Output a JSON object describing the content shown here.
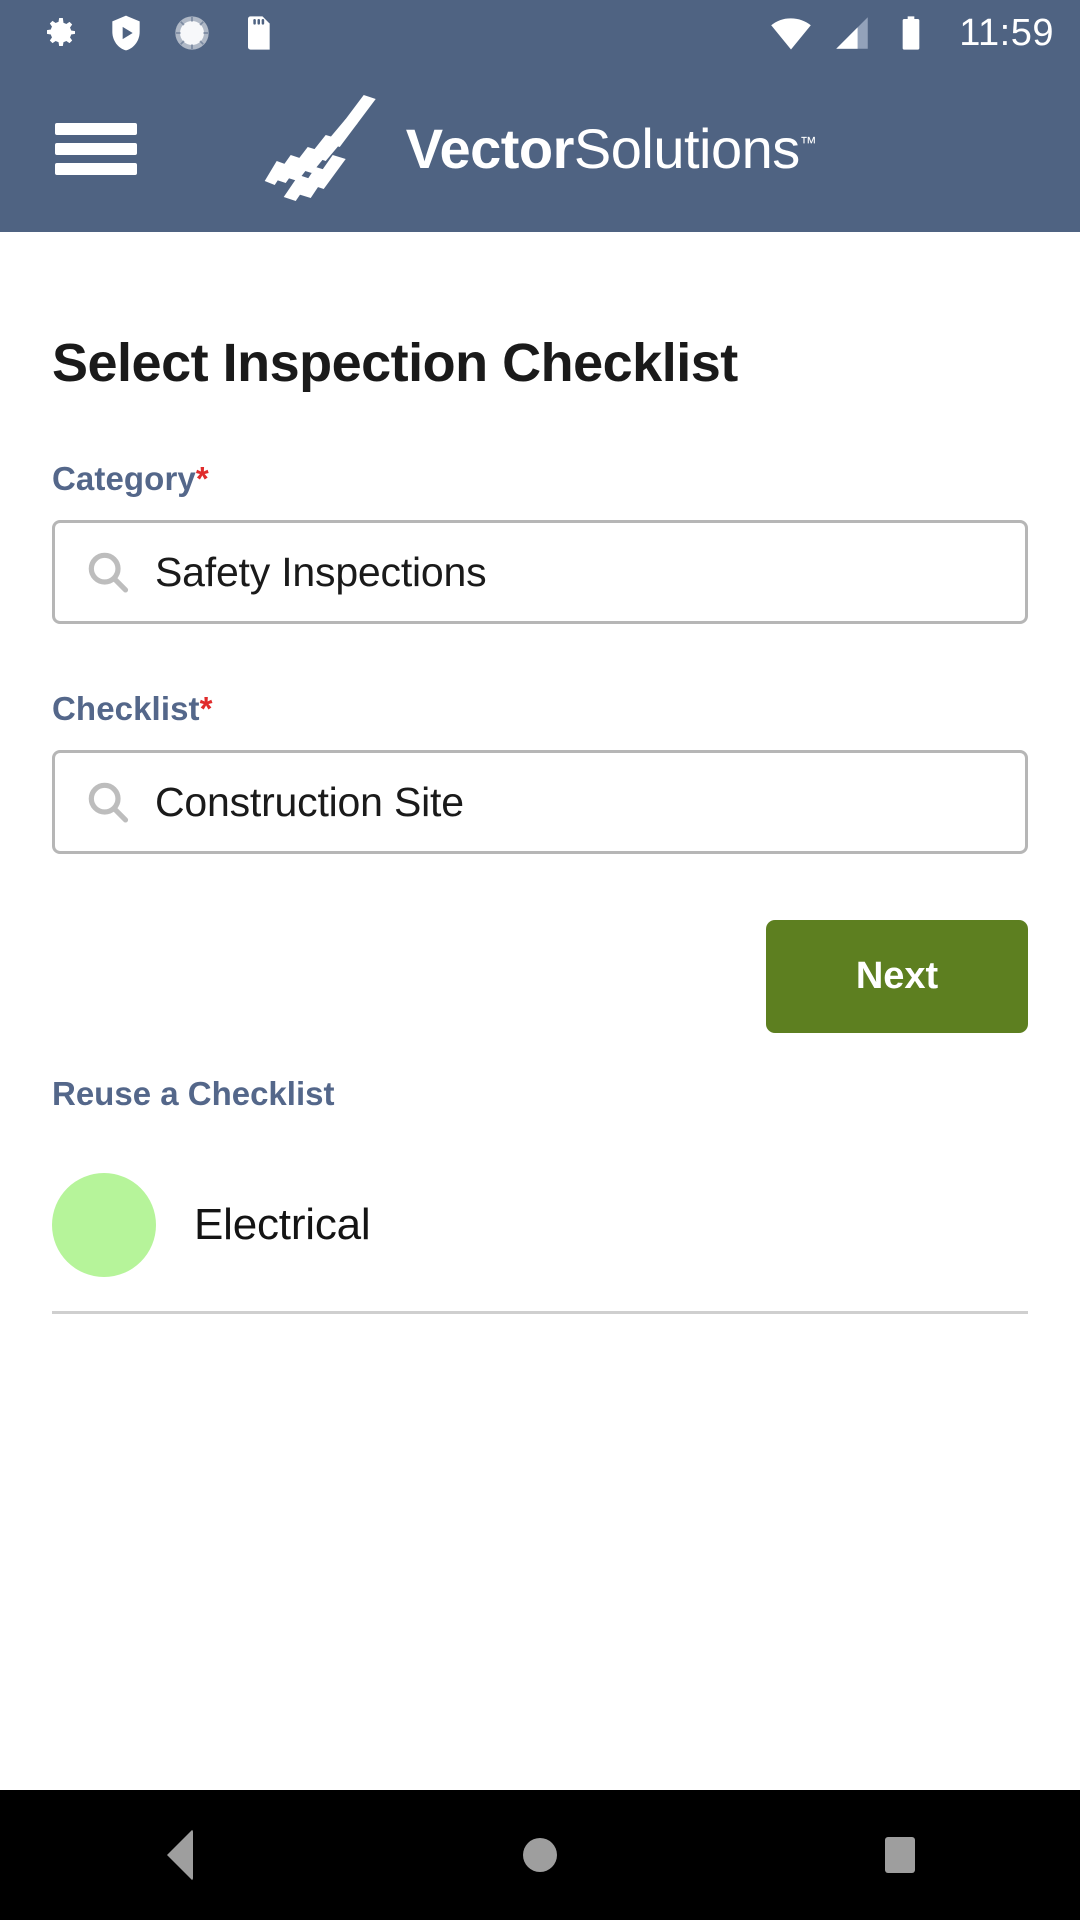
{
  "status_bar": {
    "icons": [
      "gear-icon",
      "shield-play-icon",
      "brightness-circle-icon",
      "sd-card-icon"
    ],
    "wifi_icon": "wifi-icon",
    "signal_icon": "cellular-signal-icon",
    "battery_icon": "battery-full-icon",
    "time": "11:59",
    "background_color": "#4f6382"
  },
  "app_bar": {
    "menu_icon": "hamburger-menu-icon",
    "logo_mark": "vector-chevron-logo-icon",
    "brand_bold": "Vector",
    "brand_light": "Solutions",
    "trademark": "™",
    "background_color": "#4f6382"
  },
  "main": {
    "title": "Select Inspection Checklist",
    "category": {
      "label": "Category",
      "required_marker": "*",
      "search_icon": "search-icon",
      "value": "Safety Inspections",
      "placeholder": "Safety Inspections"
    },
    "checklist": {
      "label": "Checklist",
      "required_marker": "*",
      "search_icon": "search-icon",
      "value": "Construction Site",
      "placeholder": "Construction Site"
    },
    "next_button": {
      "label": "Next",
      "color": "#5d7f20"
    },
    "reuse": {
      "title": "Reuse a Checklist",
      "items": [
        {
          "label": "Electrical",
          "avatar_color": "#b6f49a"
        }
      ]
    }
  },
  "nav_bar": {
    "back_label": "back-button",
    "home_label": "home-button",
    "recents_label": "recents-button",
    "background_color": "#000000"
  },
  "theme": {
    "header_blue": "#4f6382",
    "label_blue": "#54678a",
    "required_red": "#e02b2b",
    "button_green": "#5d7f20",
    "avatar_green": "#b6f49a",
    "border_gray": "#b6b6b6"
  }
}
